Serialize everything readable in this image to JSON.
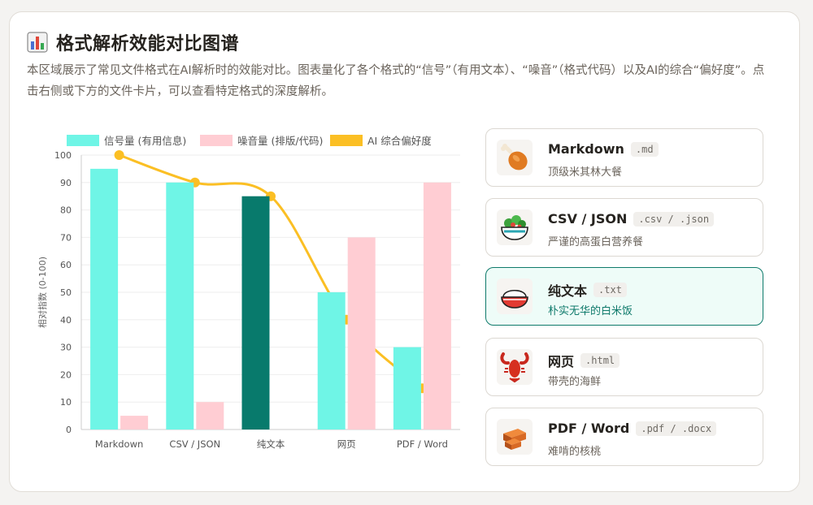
{
  "section": {
    "title": "格式解析效能对比图谱",
    "description": "本区域展示了常见文件格式在AI解析时的效能对比。图表量化了各个格式的“信号”（有用文本）、“噪音”（格式代码）以及AI的综合“偏好度”。点击右侧或下方的文件卡片，可以查看特定格式的深度解析。",
    "icon": "bar-chart-icon"
  },
  "chart_data": {
    "type": "bar",
    "categories": [
      "Markdown",
      "CSV / JSON",
      "纯文本",
      "网页",
      "PDF / Word"
    ],
    "series": [
      {
        "name": "信号量 (有用信息)",
        "type": "bar",
        "values": [
          95,
          90,
          85,
          50,
          30
        ],
        "color": "#6ff5e6",
        "highlight_color": "#087a6c"
      },
      {
        "name": "噪音量 (排版/代码)",
        "type": "bar",
        "values": [
          5,
          10,
          0,
          70,
          90
        ],
        "color": "#ffcdd3"
      },
      {
        "name": "AI 综合偏好度",
        "type": "line",
        "values": [
          100,
          90,
          85,
          40,
          15
        ],
        "color": "#fbbf24"
      }
    ],
    "highlighted_category": "纯文本",
    "ylabel": "相对指数 (0-100)",
    "ylim": [
      0,
      100
    ],
    "yticks": [
      0,
      10,
      20,
      30,
      40,
      50,
      60,
      70,
      80,
      90,
      100
    ],
    "grid": true,
    "legend": "top"
  },
  "formats": [
    {
      "name": "Markdown",
      "ext": ".md",
      "desc": "顶级米其林大餐",
      "icon": "drumstick-icon",
      "active": false
    },
    {
      "name": "CSV / JSON",
      "ext": ".csv / .json",
      "desc": "严谨的高蛋白营养餐",
      "icon": "salad-bowl-icon",
      "active": false
    },
    {
      "name": "纯文本",
      "ext": ".txt",
      "desc": "朴实无华的白米饭",
      "icon": "rice-bowl-icon",
      "active": true
    },
    {
      "name": "网页",
      "ext": ".html",
      "desc": "带壳的海鲜",
      "icon": "lobster-icon",
      "active": false
    },
    {
      "name": "PDF / Word",
      "ext": ".pdf / .docx",
      "desc": "难啃的核桃",
      "icon": "bricks-icon",
      "active": false
    }
  ]
}
